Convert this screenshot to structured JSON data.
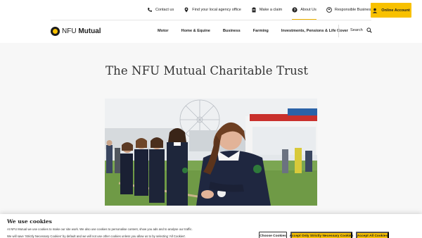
{
  "utility_bar": {
    "items": [
      {
        "label": "Contact us",
        "icon": "phone-icon"
      },
      {
        "label": "Find your local agency office",
        "icon": "location-pin-icon"
      },
      {
        "label": "Make a claim",
        "icon": "clipboard-icon"
      },
      {
        "label": "About Us",
        "icon": "question-icon",
        "active": true
      },
      {
        "label": "Responsible Business",
        "icon": "leaf-globe-icon"
      }
    ],
    "online_account": {
      "label": "Online Account",
      "icon": "user-icon"
    }
  },
  "brand": {
    "name_light": "NFU",
    "name_bold": "Mutual",
    "accent": "#f8c100"
  },
  "nav": {
    "items": [
      "Motor",
      "Home & Equine",
      "Business",
      "Farming",
      "Investments, Pensions & Life Cover"
    ],
    "search_label": "Search"
  },
  "main": {
    "title": "The NFU Mutual Charitable Trust",
    "hero_alt": "Young farmers in a tug of war at an agricultural show"
  },
  "cookie_banner": {
    "heading": "We use cookies",
    "line1": "At NFU Mutual we use cookies to make our site work. We also use cookies to personalise content, show you ads and to analyse our traffic.",
    "line2": "We will save 'Strictly Necessary Cookies' by default and we will not use other cookies unless you allow us to by selecting 'All Cookies'.",
    "buttons": {
      "choose": "Choose Cookies",
      "accept_necessary": "Accept Only Strictly Necessary Cookies",
      "accept_all": "Accept All Cookies"
    }
  }
}
